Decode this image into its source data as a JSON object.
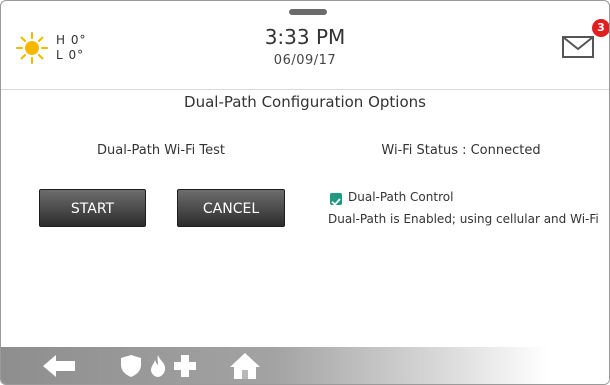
{
  "weather": {
    "icon": "sun-icon",
    "high": "H 0°",
    "low": "L 0°"
  },
  "clock": {
    "time": "3:33 PM",
    "date": "06/09/17"
  },
  "messages": {
    "icon": "envelope-icon",
    "count": "3",
    "badge_color": "#e02020"
  },
  "page": {
    "title": "Dual-Path Configuration Options"
  },
  "wifi_test": {
    "heading": "Dual-Path Wi-Fi Test",
    "start_label": "START",
    "cancel_label": "CANCEL"
  },
  "wifi_status": {
    "heading": "Wi-Fi Status : Connected",
    "control_label": "Dual-Path Control",
    "control_checked": true,
    "check_color": "#1e9a80",
    "status_text": "Dual-Path is Enabled; using cellular and Wi-Fi"
  },
  "nav": {
    "back_icon": "back-arrow-icon",
    "security_icon": "shield-icon",
    "fire_icon": "flame-icon",
    "medical_icon": "medical-cross-icon",
    "home_icon": "home-icon"
  }
}
